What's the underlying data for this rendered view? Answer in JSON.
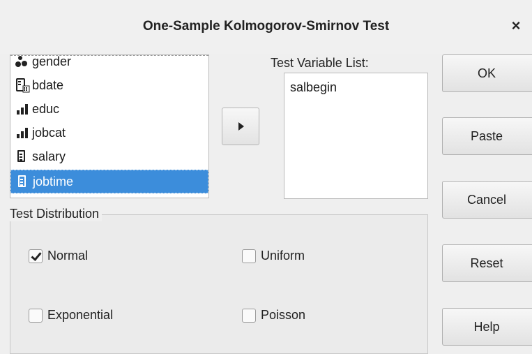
{
  "window": {
    "title": "One-Sample Kolmogorov-Smirnov Test",
    "close_glyph": "×"
  },
  "source_list": {
    "items": [
      {
        "label": "gender",
        "icon": "nominal-icon",
        "selected": false
      },
      {
        "label": "bdate",
        "icon": "date-scale-icon",
        "selected": false
      },
      {
        "label": "educ",
        "icon": "ordinal-icon",
        "selected": false
      },
      {
        "label": "jobcat",
        "icon": "ordinal-icon",
        "selected": false
      },
      {
        "label": "salary",
        "icon": "scale-icon",
        "selected": false
      },
      {
        "label": "jobtime",
        "icon": "scale-icon",
        "selected": true
      }
    ]
  },
  "move_button": {
    "icon": "right-arrow-icon"
  },
  "test_variable_list": {
    "label": "Test Variable List:",
    "items": [
      "salbegin"
    ]
  },
  "buttons": {
    "ok": "OK",
    "paste": "Paste",
    "cancel": "Cancel",
    "reset": "Reset",
    "help": "Help"
  },
  "test_distribution": {
    "label": "Test Distribution",
    "options": [
      {
        "label": "Normal",
        "checked": true
      },
      {
        "label": "Uniform",
        "checked": false
      },
      {
        "label": "Exponential",
        "checked": false
      },
      {
        "label": "Poisson",
        "checked": false
      }
    ]
  },
  "colors": {
    "selection": "#3c8ddb",
    "background": "#efefef"
  }
}
